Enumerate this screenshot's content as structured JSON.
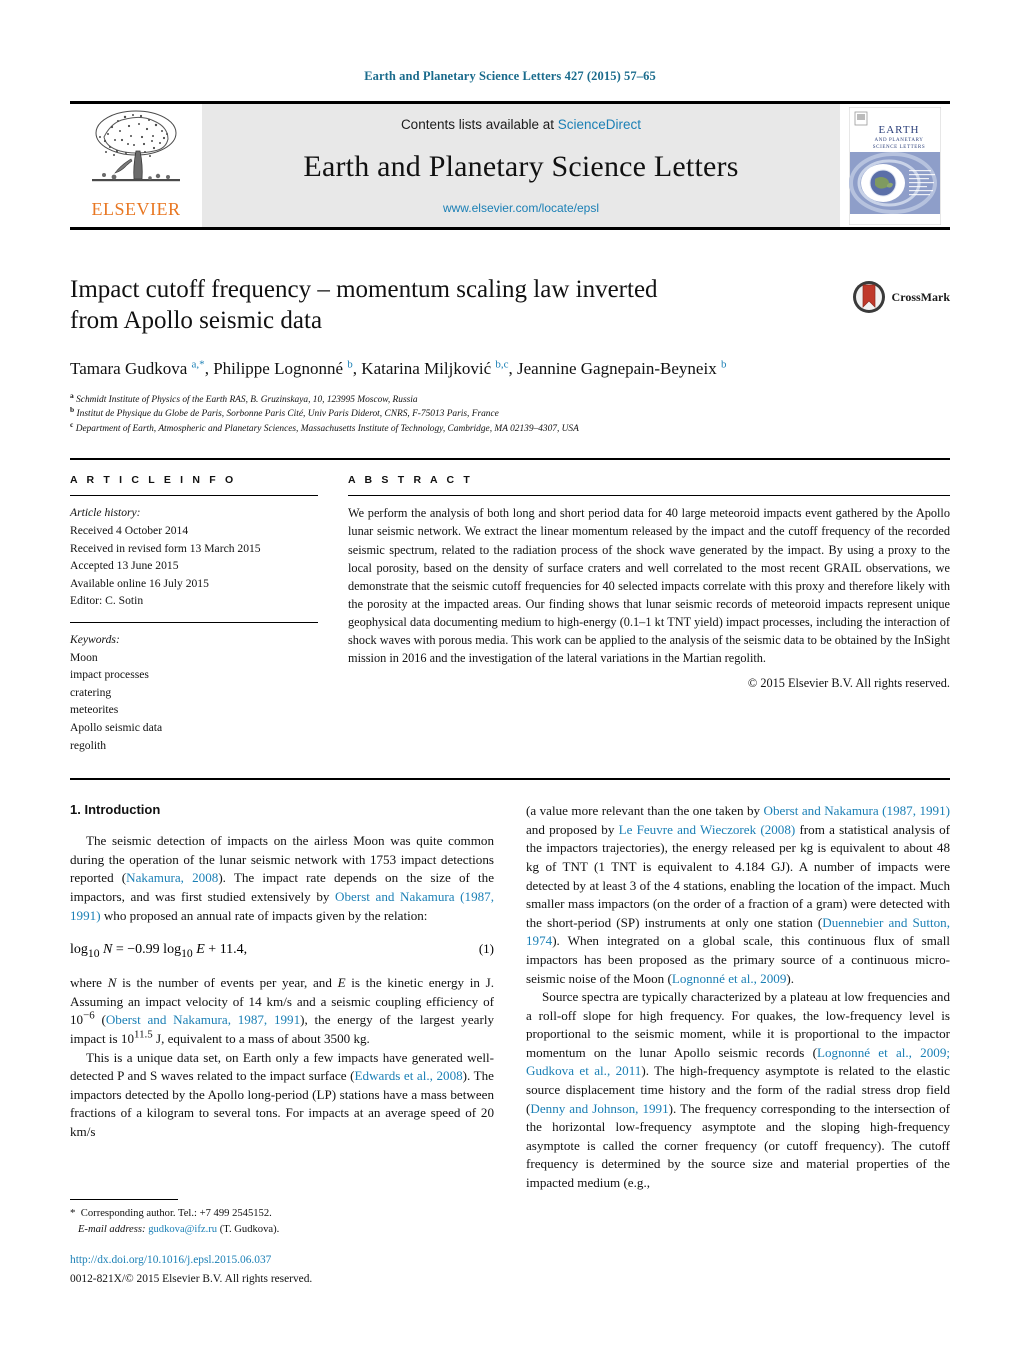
{
  "running_head": "Earth and Planetary Science Letters 427 (2015) 57–65",
  "masthead": {
    "publisher_name": "ELSEVIER",
    "contents_prefix": "Contents lists available at ",
    "sciencedirect_label": "ScienceDirect",
    "journal_title": "Earth and Planetary Science Letters",
    "journal_url": "www.elsevier.com/locate/epsl",
    "cover_title_line1": "EARTH",
    "cover_title_line2": "AND PLANETARY",
    "cover_title_line3": "SCIENCE LETTERS"
  },
  "article": {
    "title": "Impact cutoff frequency – momentum scaling law inverted from Apollo seismic data",
    "crossmark_label": "CrossMark",
    "authors_html": "Tamara Gudkova <sup>a,*</sup>, Philippe Lognonné <sup>b</sup>, Katarina Miljković <sup>b,c</sup>, Jeannine Gagnepain-Beyneix <sup>b</sup>",
    "affiliations": [
      {
        "marker": "a",
        "text": "Schmidt Institute of Physics of the Earth RAS, B. Gruzinskaya, 10, 123995 Moscow, Russia"
      },
      {
        "marker": "b",
        "text": "Institut de Physique du Globe de Paris, Sorbonne Paris Cité, Univ Paris Diderot, CNRS, F-75013 Paris, France"
      },
      {
        "marker": "c",
        "text": "Department of Earth, Atmospheric and Planetary Sciences, Massachusetts Institute of Technology, Cambridge, MA 02139–4307, USA"
      }
    ]
  },
  "article_info": {
    "heading": "A R T I C L E   I N F O",
    "history_label": "Article history:",
    "history": [
      "Received 4 October 2014",
      "Received in revised form 13 March 2015",
      "Accepted 13 June 2015",
      "Available online 16 July 2015",
      "Editor: C. Sotin"
    ],
    "keywords_label": "Keywords:",
    "keywords": [
      "Moon",
      "impact processes",
      "cratering",
      "meteorites",
      "Apollo seismic data",
      "regolith"
    ]
  },
  "abstract": {
    "heading": "A B S T R A C T",
    "text": "We perform the analysis of both long and short period data for 40 large meteoroid impacts event gathered by the Apollo lunar seismic network. We extract the linear momentum released by the impact and the cutoff frequency of the recorded seismic spectrum, related to the radiation process of the shock wave generated by the impact. By using a proxy to the local porosity, based on the density of surface craters and well correlated to the most recent GRAIL observations, we demonstrate that the seismic cutoff frequencies for 40 selected impacts correlate with this proxy and therefore likely with the porosity at the impacted areas. Our finding shows that lunar seismic records of meteoroid impacts represent unique geophysical data documenting medium to high-energy (0.1–1 kt TNT yield) impact processes, including the interaction of shock waves with porous media. This work can be applied to the analysis of the seismic data to be obtained by the InSight mission in 2016 and the investigation of the lateral variations in the Martian regolith.",
    "copyright": "© 2015 Elsevier B.V. All rights reserved."
  },
  "body": {
    "section1_title": "1. Introduction",
    "left_para1_html": "The seismic detection of impacts on the airless Moon was quite common during the operation of the lunar seismic network with 1753 impact detections reported (<span class=\"ref\">Nakamura, 2008</span>). The impact rate depends on the size of the impactors, and was first studied extensively by <span class=\"ref\">Oberst and Nakamura (1987, 1991)</span> who proposed an annual rate of impacts given by the relation:",
    "equation_html": "log<sub>10</sub> <i>N</i> = −0.99 log<sub>10</sub> <i>E</i> + 11.4,",
    "equation_number": "(1)",
    "left_para2_html": "where <i>N</i> is the number of events per year, and <i>E</i> is the kinetic energy in J. Assuming an impact velocity of 14 km/s and a seismic coupling efficiency of 10<sup>−6</sup> (<span class=\"ref\">Oberst and Nakamura, 1987, 1991</span>), the energy of the largest yearly impact is 10<sup>11.5</sup> J, equivalent to a mass of about 3500 kg.",
    "left_para3_html": "This is a unique data set, on Earth only a few impacts have generated well-detected P and S waves related to the impact surface (<span class=\"ref\">Edwards et al., 2008</span>). The impactors detected by the Apollo long-period (LP) stations have a mass between fractions of a kilogram to several tons. For impacts at an average speed of 20 km/s",
    "right_para1_html": "(a value more relevant than the one taken by <span class=\"ref\">Oberst and Nakamura (1987, 1991)</span> and proposed by <span class=\"ref\">Le Feuvre and Wieczorek (2008)</span> from a statistical analysis of the impactors trajectories), the energy released per kg is equivalent to about 48 kg of TNT (1 TNT is equivalent to 4.184 GJ). A number of impacts were detected by at least 3 of the 4 stations, enabling the location of the impact. Much smaller mass impactors (on the order of a fraction of a gram) were detected with the short-period (SP) instruments at only one station (<span class=\"ref\">Duennebier and Sutton, 1974</span>). When integrated on a global scale, this continuous flux of small impactors has been proposed as the primary source of a continuous micro-seismic noise of the Moon (<span class=\"ref\">Lognonné et al., 2009</span>).",
    "right_para2_html": "Source spectra are typically characterized by a plateau at low frequencies and a roll-off slope for high frequency. For quakes, the low-frequency level is proportional to the seismic moment, while it is proportional to the impactor momentum on the lunar Apollo seismic records (<span class=\"ref\">Lognonné et al., 2009; Gudkova et al., 2011</span>). The high-frequency asymptote is related to the elastic source displacement time history and the form of the radial stress drop field (<span class=\"ref\">Denny and Johnson, 1991</span>). The frequency corresponding to the intersection of the horizontal low-frequency asymptote and the sloping high-frequency asymptote is called the corner frequency (or cutoff frequency). The cutoff frequency is determined by the source size and material properties of the impacted medium (e.g.,"
  },
  "footer": {
    "corresponding_html": "<span class=\"star\">*</span>&nbsp;&nbsp;Corresponding author. Tel.: +7 499 2545152.",
    "email_label": "E-mail address:",
    "email_address": "gudkova@ifz.ru",
    "email_suffix": "(T. Gudkova).",
    "doi": "http://dx.doi.org/10.1016/j.epsl.2015.06.037",
    "issn_line": "0012-821X/© 2015 Elsevier B.V. All rights reserved."
  },
  "colors": {
    "link": "#1a7fb5",
    "running_head": "#1a6b8c",
    "elsevier_orange": "#E87722",
    "masthead_bg": "#e8e8e8",
    "crossmark_red": "#c0392b"
  }
}
